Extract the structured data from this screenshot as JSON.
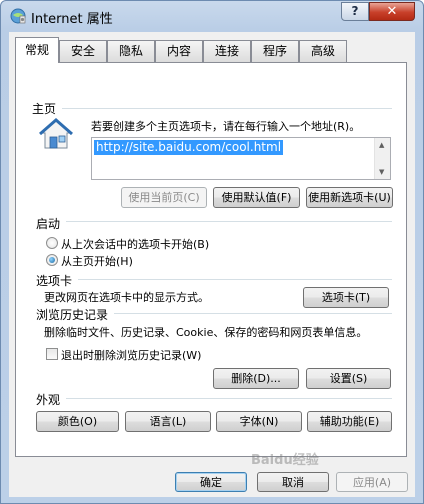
{
  "window": {
    "title": "Internet 属性",
    "help_label": "?",
    "close_label": "✕"
  },
  "tabs": [
    {
      "label": "常规",
      "active": true
    },
    {
      "label": "安全"
    },
    {
      "label": "隐私"
    },
    {
      "label": "内容"
    },
    {
      "label": "连接"
    },
    {
      "label": "程序"
    },
    {
      "label": "高级"
    }
  ],
  "homepage": {
    "section_label": "主页",
    "instruction": "若要创建多个主页选项卡，请在每行输入一个地址(R)。",
    "url": "http://site.baidu.com/cool.html",
    "btn_use_current": "使用当前页(C)",
    "btn_use_default": "使用默认值(F)",
    "btn_use_new_tab": "使用新选项卡(U)"
  },
  "startup": {
    "section_label": "启动",
    "option_last_session": "从上次会话中的选项卡开始(B)",
    "option_homepage": "从主页开始(H)",
    "selected": "option_homepage"
  },
  "tabs_section": {
    "section_label": "选项卡",
    "description": "更改网页在选项卡中的显示方式。",
    "btn_tabs": "选项卡(T)"
  },
  "history": {
    "section_label": "浏览历史记录",
    "description": "删除临时文件、历史记录、Cookie、保存的密码和网页表单信息。",
    "checkbox_delete_on_exit": "退出时删除浏览历史记录(W)",
    "checkbox_checked": false,
    "btn_delete": "删除(D)...",
    "btn_settings": "设置(S)"
  },
  "appearance": {
    "section_label": "外观",
    "btn_colors": "颜色(O)",
    "btn_languages": "语言(L)",
    "btn_fonts": "字体(N)",
    "btn_accessibility": "辅助功能(E)"
  },
  "dialog_buttons": {
    "ok": "确定",
    "cancel": "取消",
    "apply": "应用(A)"
  },
  "watermark": "Baidu经验",
  "colors": {
    "selection": "#3399ff",
    "close_button": "#c8402a",
    "panel_bg": "#ffffff",
    "dialog_bg": "#f0f0f0"
  }
}
